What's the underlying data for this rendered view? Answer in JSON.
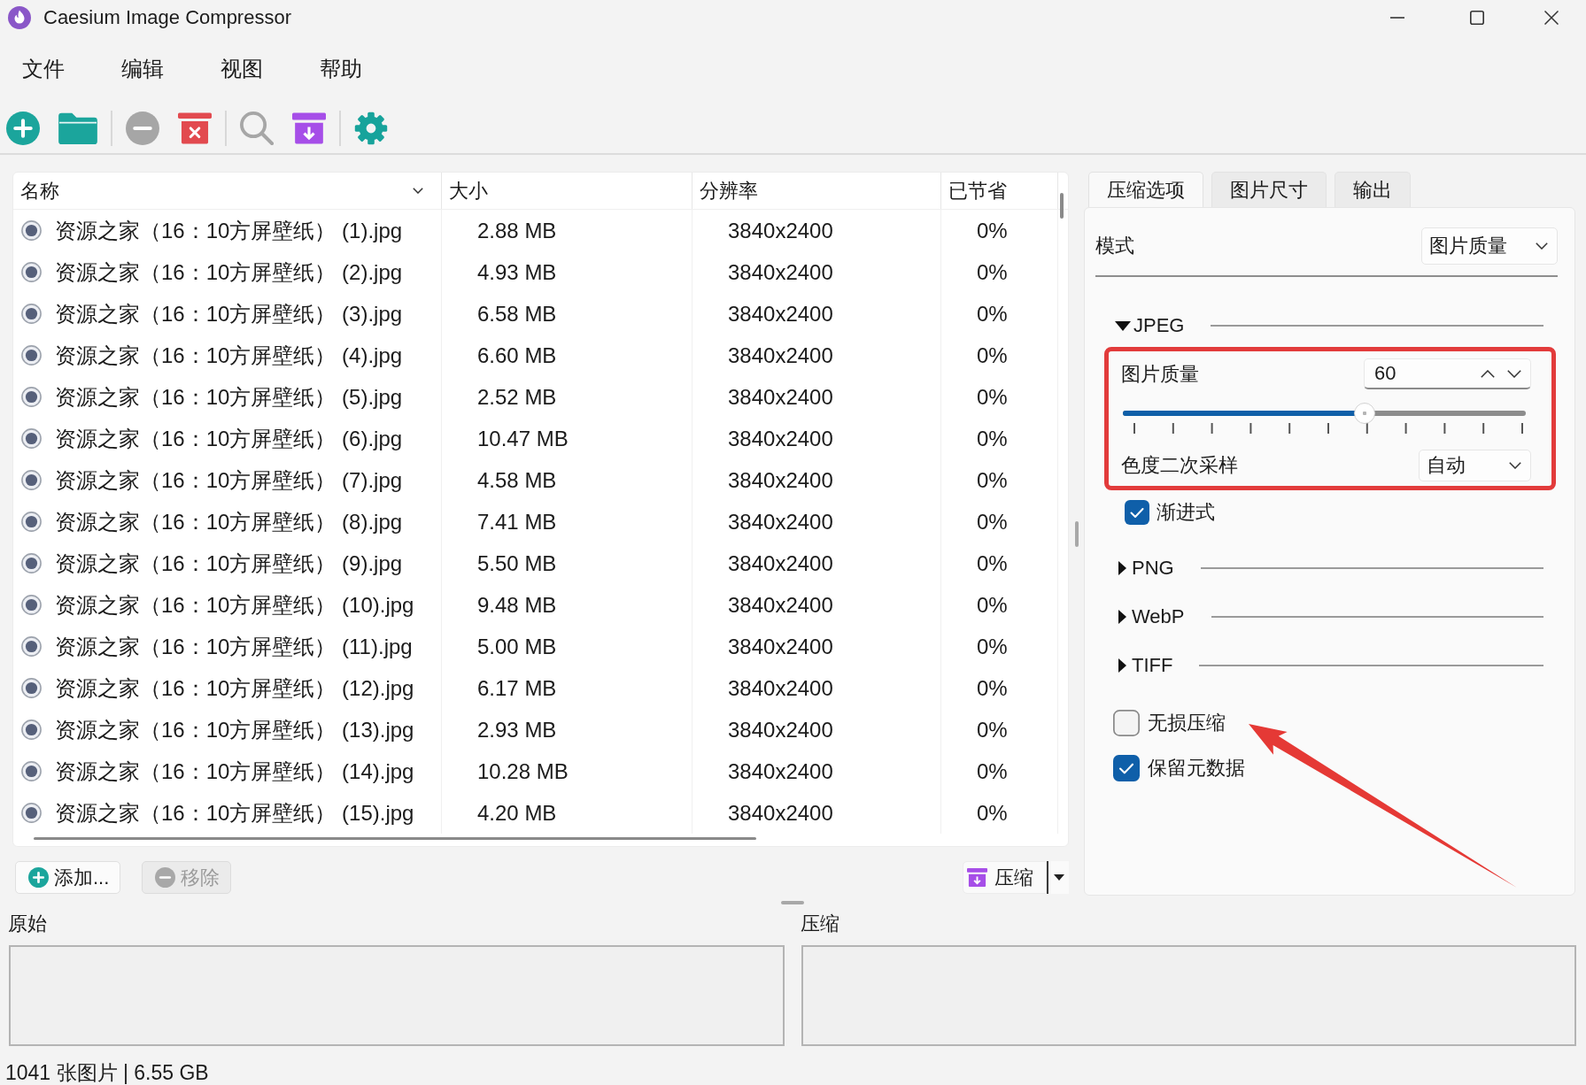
{
  "window": {
    "title": "Caesium Image Compressor"
  },
  "menu": [
    {
      "label": "文件"
    },
    {
      "label": "编辑"
    },
    {
      "label": "视图"
    },
    {
      "label": "帮助"
    }
  ],
  "toolbar": [
    [
      {
        "kind": "add",
        "disabled": false
      },
      {
        "kind": "open",
        "disabled": false
      }
    ],
    [
      {
        "kind": "remove",
        "disabled": true
      },
      {
        "kind": "clear",
        "disabled": false
      }
    ],
    [
      {
        "kind": "preview",
        "disabled": true
      },
      {
        "kind": "compress",
        "disabled": false
      }
    ],
    [
      {
        "kind": "settings",
        "disabled": false
      }
    ]
  ],
  "file_list": {
    "columns": [
      {
        "label": "名称",
        "sorted": true
      },
      {
        "label": "大小",
        "sorted": false
      },
      {
        "label": "分辨率",
        "sorted": false
      },
      {
        "label": "已节省",
        "sorted": false
      }
    ],
    "rows": [
      {
        "name": "资源之家（16：10方屏壁纸） (1).jpg",
        "size": "2.88 MB",
        "resolution": "3840x2400",
        "saved": "0%"
      },
      {
        "name": "资源之家（16：10方屏壁纸） (2).jpg",
        "size": "4.93 MB",
        "resolution": "3840x2400",
        "saved": "0%"
      },
      {
        "name": "资源之家（16：10方屏壁纸） (3).jpg",
        "size": "6.58 MB",
        "resolution": "3840x2400",
        "saved": "0%"
      },
      {
        "name": "资源之家（16：10方屏壁纸） (4).jpg",
        "size": "6.60 MB",
        "resolution": "3840x2400",
        "saved": "0%"
      },
      {
        "name": "资源之家（16：10方屏壁纸） (5).jpg",
        "size": "2.52 MB",
        "resolution": "3840x2400",
        "saved": "0%"
      },
      {
        "name": "资源之家（16：10方屏壁纸） (6).jpg",
        "size": "10.47 MB",
        "resolution": "3840x2400",
        "saved": "0%"
      },
      {
        "name": "资源之家（16：10方屏壁纸） (7).jpg",
        "size": "4.58 MB",
        "resolution": "3840x2400",
        "saved": "0%"
      },
      {
        "name": "资源之家（16：10方屏壁纸） (8).jpg",
        "size": "7.41 MB",
        "resolution": "3840x2400",
        "saved": "0%"
      },
      {
        "name": "资源之家（16：10方屏壁纸） (9).jpg",
        "size": "5.50 MB",
        "resolution": "3840x2400",
        "saved": "0%"
      },
      {
        "name": "资源之家（16：10方屏壁纸） (10).jpg",
        "size": "9.48 MB",
        "resolution": "3840x2400",
        "saved": "0%"
      },
      {
        "name": "资源之家（16：10方屏壁纸） (11).jpg",
        "size": "5.00 MB",
        "resolution": "3840x2400",
        "saved": "0%"
      },
      {
        "name": "资源之家（16：10方屏壁纸） (12).jpg",
        "size": "6.17 MB",
        "resolution": "3840x2400",
        "saved": "0%"
      },
      {
        "name": "资源之家（16：10方屏壁纸） (13).jpg",
        "size": "2.93 MB",
        "resolution": "3840x2400",
        "saved": "0%"
      },
      {
        "name": "资源之家（16：10方屏壁纸） (14).jpg",
        "size": "10.28 MB",
        "resolution": "3840x2400",
        "saved": "0%"
      },
      {
        "name": "资源之家（16：10方屏壁纸） (15).jpg",
        "size": "4.20 MB",
        "resolution": "3840x2400",
        "saved": "0%"
      }
    ]
  },
  "list_buttons": [
    {
      "kind": "add",
      "label": "添加...",
      "disabled": false
    },
    {
      "kind": "remove",
      "label": "移除",
      "disabled": true
    }
  ],
  "compress_button": {
    "label": "压缩"
  },
  "options_panel": {
    "tabs": [
      {
        "label": "压缩选项",
        "selected": true
      },
      {
        "label": "图片尺寸",
        "selected": false
      },
      {
        "label": "输出",
        "selected": false
      }
    ],
    "mode": {
      "label": "模式",
      "value": "图片质量"
    },
    "formats": [
      {
        "label": "JPEG",
        "expanded": true,
        "settings": {
          "highlighted": true,
          "quality": {
            "label": "图片质量",
            "value": "60",
            "level": 0.6
          },
          "chroma_subsampling": {
            "label": "色度二次采样",
            "value": "自动"
          },
          "progressive": {
            "label": "渐进式",
            "checked": true
          }
        }
      },
      {
        "label": "PNG",
        "expanded": false
      },
      {
        "label": "WebP",
        "expanded": false
      },
      {
        "label": "TIFF",
        "expanded": false
      }
    ],
    "options": [
      {
        "label": "无损压缩",
        "checked": false
      },
      {
        "label": "保留元数据",
        "checked": true
      }
    ]
  },
  "preview": {
    "original_label": "原始",
    "compressed_label": "压缩"
  },
  "status_bar": {
    "text": "1041 张图片 | 6.55 GB"
  },
  "annotations": [
    {
      "kind": "arrow"
    }
  ]
}
